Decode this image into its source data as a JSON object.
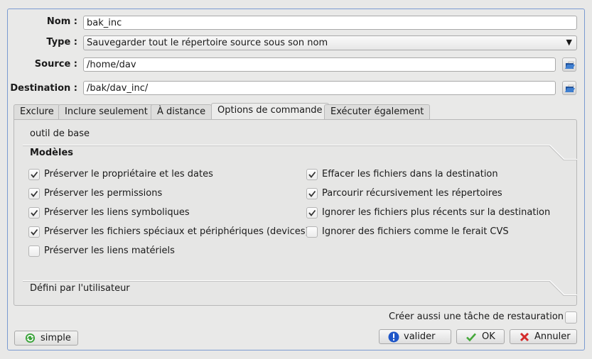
{
  "form": {
    "name_label": "Nom :",
    "name_value": "bak_inc",
    "type_label": "Type :",
    "type_value": "Sauvegarder tout le répertoire source sous son nom",
    "source_label": "Source :",
    "source_value": "/home/dav",
    "destination_label": "Destination :",
    "destination_value": "/bak/dav_inc/"
  },
  "tabs": [
    {
      "label": "Exclure"
    },
    {
      "label": "Inclure seulement"
    },
    {
      "label": "À distance"
    },
    {
      "label": "Options de commande",
      "active": true
    },
    {
      "label": "Exécuter également"
    }
  ],
  "panel": {
    "base_tool_label": "outil de base",
    "models_title": "Modèles",
    "user_defined_label": "Défini par l'utilisateur",
    "options_left": [
      {
        "label": "Préserver le propriétaire et les dates",
        "checked": true
      },
      {
        "label": "Préserver les permissions",
        "checked": true
      },
      {
        "label": "Préserver les liens symboliques",
        "checked": true
      },
      {
        "label": "Préserver les fichiers spéciaux et périphériques (devices)",
        "checked": true
      },
      {
        "label": "Préserver les liens matériels",
        "checked": false
      }
    ],
    "options_right": [
      {
        "label": "Effacer les fichiers dans la destination",
        "checked": true
      },
      {
        "label": "Parcourir récursivement les répertoires",
        "checked": true
      },
      {
        "label": "Ignorer les fichiers plus récents sur la destination",
        "checked": true
      },
      {
        "label": "Ignorer des fichiers comme le ferait CVS",
        "checked": false
      }
    ]
  },
  "footer": {
    "restore_task_label": "Créer aussi une tâche de restauration",
    "restore_task_checked": false,
    "simple_label": "simple",
    "validate_label": "valider",
    "ok_label": "OK",
    "cancel_label": "Annuler"
  }
}
